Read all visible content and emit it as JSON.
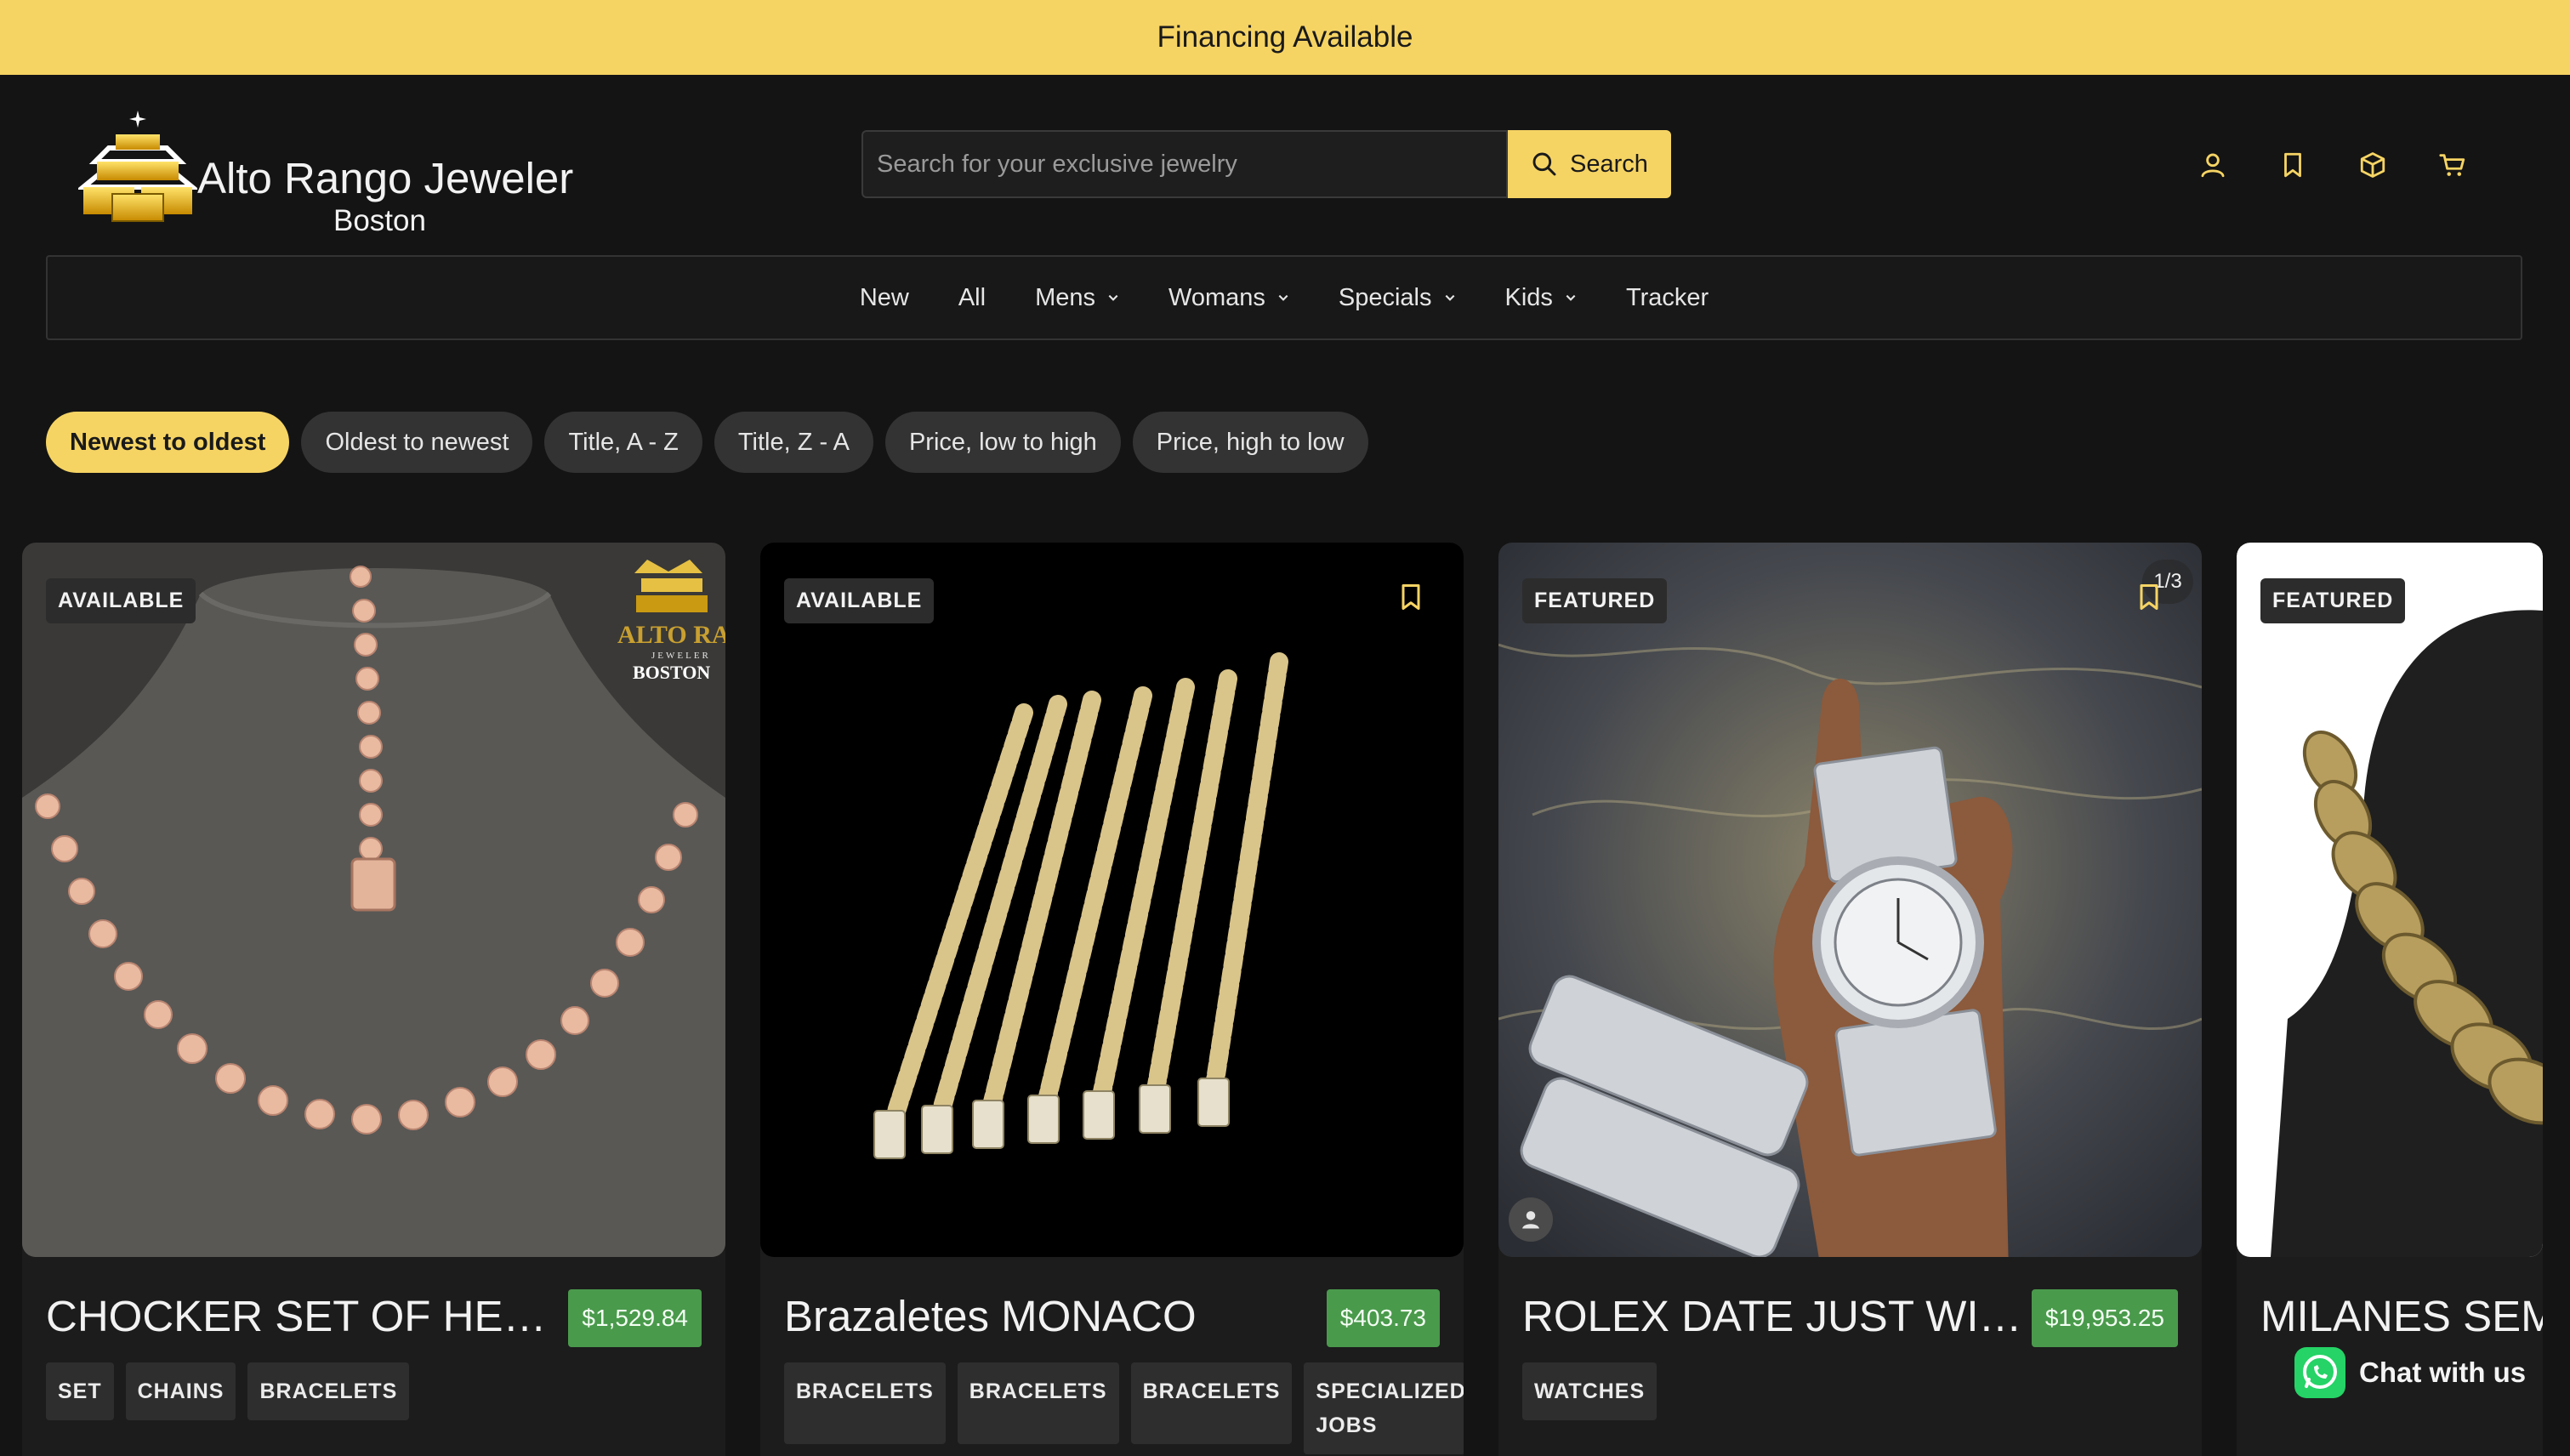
{
  "announcement": "Financing Available",
  "brand": {
    "name": "Alto Rango Jeweler",
    "city": "Boston"
  },
  "search": {
    "placeholder": "Search for your exclusive jewelry",
    "button_label": "Search"
  },
  "header_icons": [
    "user-icon",
    "bookmark-icon",
    "box-icon",
    "cart-icon"
  ],
  "nav": [
    {
      "label": "New",
      "has_dropdown": false
    },
    {
      "label": "All",
      "has_dropdown": false
    },
    {
      "label": "Mens",
      "has_dropdown": true
    },
    {
      "label": "Womans",
      "has_dropdown": true
    },
    {
      "label": "Specials",
      "has_dropdown": true
    },
    {
      "label": "Kids",
      "has_dropdown": true
    },
    {
      "label": "Tracker",
      "has_dropdown": false
    }
  ],
  "sort_options": [
    "Newest to oldest",
    "Oldest to newest",
    "Title, A - Z",
    "Title, Z - A",
    "Price, low to high",
    "Price, high to low"
  ],
  "active_sort": "Newest to oldest",
  "products": [
    {
      "badge": "AVAILABLE",
      "title": "CHOCKER SET OF HEARTS",
      "price": "$1,529.84",
      "tags": [
        "SET",
        "CHAINS",
        "BRACELETS"
      ],
      "watermark": [
        "ALTO RANGO",
        "JEWELER",
        "BOSTON"
      ]
    },
    {
      "badge": "AVAILABLE",
      "title": "Brazaletes MONACO",
      "price": "$403.73",
      "tags": [
        "BRACELETS",
        "BRACELETS",
        "BRACELETS",
        "SPECIALIZED JOBS"
      ]
    },
    {
      "badge": "FEATURED",
      "title": "ROLEX DATE JUST WITH DIAMONDS",
      "price": "$19,953.25",
      "tags": [
        "WATCHES"
      ],
      "image_counter": "1/3"
    },
    {
      "badge": "FEATURED",
      "title": "MILANES SEMI",
      "price": "",
      "tags": []
    }
  ],
  "chat": {
    "label": "Chat with us"
  },
  "colors": {
    "accent": "#f6d464",
    "background": "#141414",
    "price": "#4a9a4c",
    "whatsapp": "#25d366"
  }
}
